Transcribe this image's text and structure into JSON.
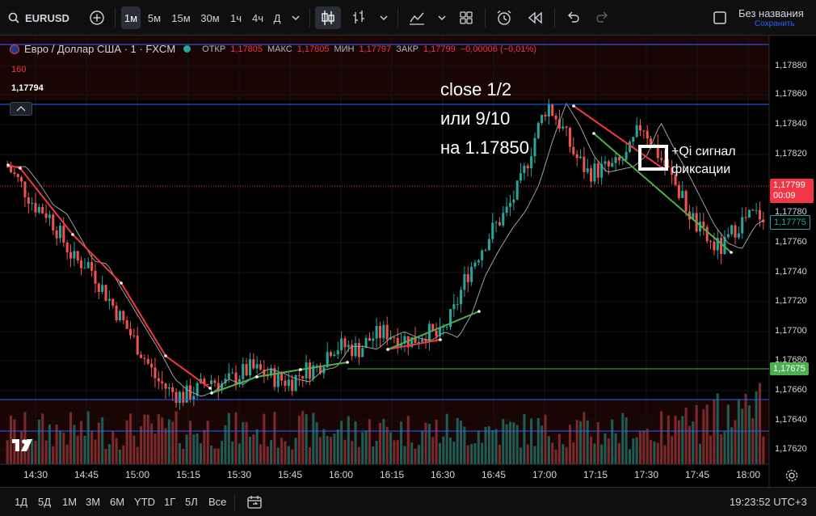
{
  "header": {
    "symbol": "EURUSD",
    "timeframes": [
      "1м",
      "5м",
      "15м",
      "30м",
      "1ч",
      "4ч",
      "Д"
    ],
    "active_timeframe": "1м",
    "layout_title": "Без названия",
    "layout_subtitle": "Сохранить"
  },
  "legend": {
    "instrument": "Евро / Доллар США · 1 · FXCM",
    "open_label": "ОТКР",
    "open": "1,17805",
    "high_label": "МАКС",
    "high": "1,17805",
    "low_label": "МИН",
    "low": "1,17797",
    "close_label": "ЗАКР",
    "close": "1,17799",
    "change": "−0,00006 (−0,01%)",
    "volume": "160",
    "indicator_value": "1,17794"
  },
  "annotations": {
    "note1_lines": [
      "close 1/2",
      "или 9/10",
      "на 1.17850"
    ],
    "note2_lines": [
      "+Qi сигнал",
      "фиксации"
    ]
  },
  "price_axis": {
    "labels": [
      "1,17880",
      "1,17860",
      "1,17840",
      "1,17820",
      "1,17780",
      "1,17760",
      "1,17740",
      "1,17720",
      "1,17700",
      "1,17680",
      "1,17660",
      "1,17640",
      "1,17620"
    ],
    "current_price": "1,17799",
    "countdown": "00:09",
    "ma_price": "1,17775",
    "line_price": "1,17675"
  },
  "time_axis": {
    "labels": [
      "14:30",
      "14:45",
      "15:00",
      "15:15",
      "15:30",
      "15:45",
      "16:00",
      "16:15",
      "16:30",
      "16:45",
      "17:00",
      "17:15",
      "17:30",
      "17:45",
      "18:00"
    ]
  },
  "bottom": {
    "ranges": [
      "1Д",
      "5Д",
      "1М",
      "3М",
      "6М",
      "YTD",
      "1Г",
      "5Л",
      "Все"
    ],
    "clock": "19:23:52 UTC+3"
  },
  "colors": {
    "up": "#26a69a",
    "down": "#ef5350",
    "up_line": "#4caf50",
    "down_line": "#f23645",
    "hline_blue": "#2962ff"
  },
  "chart_data": {
    "type": "candlestick",
    "x": [
      "14:22",
      "14:26",
      "14:30",
      "14:34",
      "14:38",
      "14:42",
      "14:46",
      "14:50",
      "14:54",
      "14:58",
      "15:02",
      "15:06",
      "15:10",
      "15:14",
      "15:18",
      "15:22",
      "15:26",
      "15:30",
      "15:34",
      "15:38",
      "15:42",
      "15:46",
      "15:50",
      "15:54",
      "15:58",
      "16:02",
      "16:06",
      "16:10",
      "16:14",
      "16:18",
      "16:22",
      "16:26",
      "16:30",
      "16:34",
      "16:38",
      "16:42",
      "16:46",
      "16:50",
      "16:54",
      "16:58",
      "17:02",
      "17:06",
      "17:10",
      "17:14",
      "17:18",
      "17:22",
      "17:26",
      "17:30",
      "17:34",
      "17:38",
      "17:42",
      "17:46",
      "17:50",
      "17:54",
      "17:58",
      "18:02",
      "18:06"
    ],
    "close": [
      1.17812,
      1.178,
      1.17786,
      1.1778,
      1.17764,
      1.17748,
      1.17746,
      1.1773,
      1.17715,
      1.177,
      1.17685,
      1.17668,
      1.1766,
      1.17656,
      1.1766,
      1.17668,
      1.17664,
      1.1767,
      1.17675,
      1.17672,
      1.17668,
      1.17666,
      1.17674,
      1.17676,
      1.1769,
      1.1769,
      1.17688,
      1.17696,
      1.177,
      1.17696,
      1.17694,
      1.177,
      1.17696,
      1.17712,
      1.17738,
      1.17755,
      1.1777,
      1.17782,
      1.178,
      1.1783,
      1.17855,
      1.1784,
      1.1782,
      1.17808,
      1.1781,
      1.17812,
      1.1782,
      1.17842,
      1.17824,
      1.17808,
      1.1779,
      1.17772,
      1.1776,
      1.17756,
      1.17772,
      1.17778,
      1.1778
    ],
    "price_range": [
      1.1761,
      1.1789
    ]
  }
}
